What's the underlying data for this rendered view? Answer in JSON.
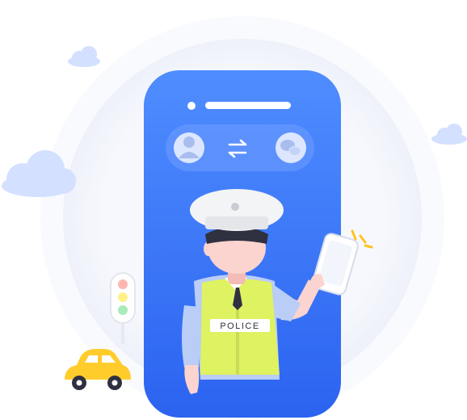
{
  "illustration": {
    "vest_label": "POLICE",
    "icons": {
      "left": "user-avatar-icon",
      "center": "swap-arrows-icon",
      "right": "wechat-icon"
    }
  },
  "colors": {
    "phone_top": "#4f8dff",
    "phone_bottom": "#2b63f0",
    "vest": "#dff261",
    "shirt": "#b9cdf7",
    "cap": "#f3f4f6",
    "hair": "#2f3140",
    "skin": "#fbd3cf",
    "car": "#ffcc2c",
    "cloud": "#d3e0ff",
    "halo": "#f4f6fc",
    "accent_ray": "#ffc31f"
  }
}
